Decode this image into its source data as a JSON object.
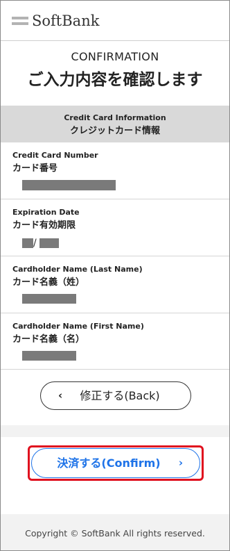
{
  "brand": {
    "logo_text": "SoftBank"
  },
  "page": {
    "title_en": "CONFIRMATION",
    "title_ja": "ご入力内容を確認します"
  },
  "section": {
    "title_en": "Credit Card Information",
    "title_ja": "クレジットカード情報"
  },
  "fields": [
    {
      "label_en": "Credit Card Number",
      "label_ja": "カード番号"
    },
    {
      "label_en": "Expiration Date",
      "label_ja": "カード有効期限",
      "separator": "/"
    },
    {
      "label_en": "Cardholder Name (Last Name)",
      "label_ja": "カード名義（姓）"
    },
    {
      "label_en": "Cardholder Name (First Name)",
      "label_ja": "カード名義（名）"
    }
  ],
  "buttons": {
    "back_label": "修正する(Back)",
    "back_icon": "‹",
    "confirm_label": "決済する(Confirm)",
    "confirm_icon": "›"
  },
  "footer": {
    "copyright": "Copyright © SoftBank All rights reserved."
  },
  "colors": {
    "accent_blue": "#1e73e8",
    "highlight_red": "#e0101e",
    "section_gray": "#d9d9d9",
    "mask_gray": "#7a7a7a"
  }
}
